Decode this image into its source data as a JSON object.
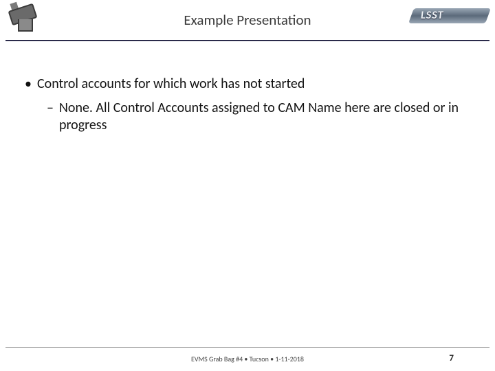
{
  "logos": {
    "left_alt": "telescope-icon",
    "right_text": "LSST"
  },
  "header": {
    "title": "Example Presentation"
  },
  "content": {
    "bullet1": "Control accounts for which work has not started",
    "sub1": "None.  All Control Accounts assigned to CAM Name here are closed or in progress"
  },
  "footer": {
    "text": "EVMS Grab Bag #4 • Tucson • 1-11-2018",
    "page": "7"
  }
}
